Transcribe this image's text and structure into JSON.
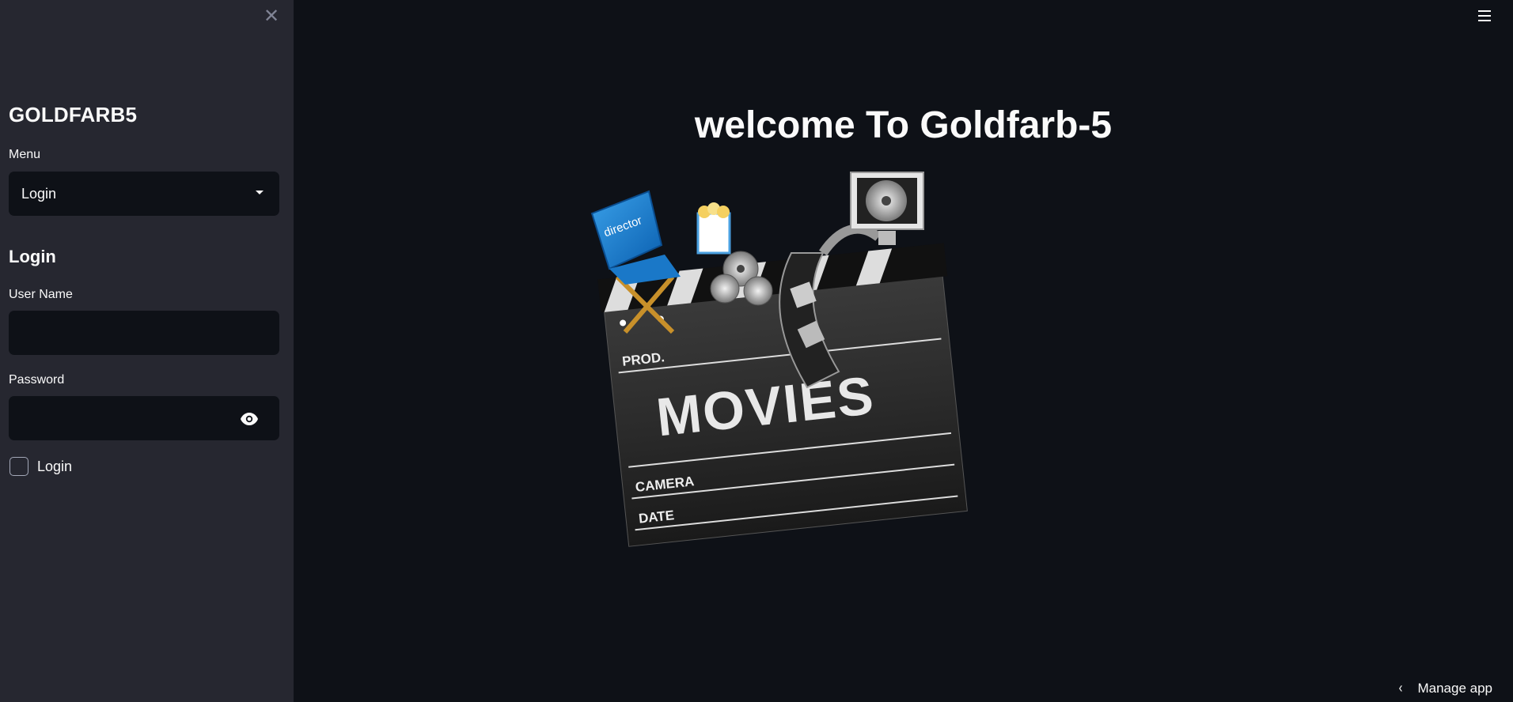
{
  "sidebar": {
    "close_icon": "close-icon",
    "brand": "GOLDFARB5",
    "menu_label": "Menu",
    "menu_selected": "Login",
    "section_title": "Login",
    "username_label": "User Name",
    "username_value": "",
    "password_label": "Password",
    "password_value": "",
    "checkbox_label": "Login",
    "checkbox_checked": false
  },
  "main": {
    "title": "welcome To Goldfarb-5",
    "image_alt_text": {
      "director": "director",
      "prod": "PROD.",
      "movies": "MOVIES",
      "camera": "CAMERA",
      "date": "DATE"
    }
  },
  "footer": {
    "manage_app": "Manage app"
  },
  "colors": {
    "sidebar_bg": "#262730",
    "main_bg": "#0e1117",
    "text": "#fafafa"
  }
}
